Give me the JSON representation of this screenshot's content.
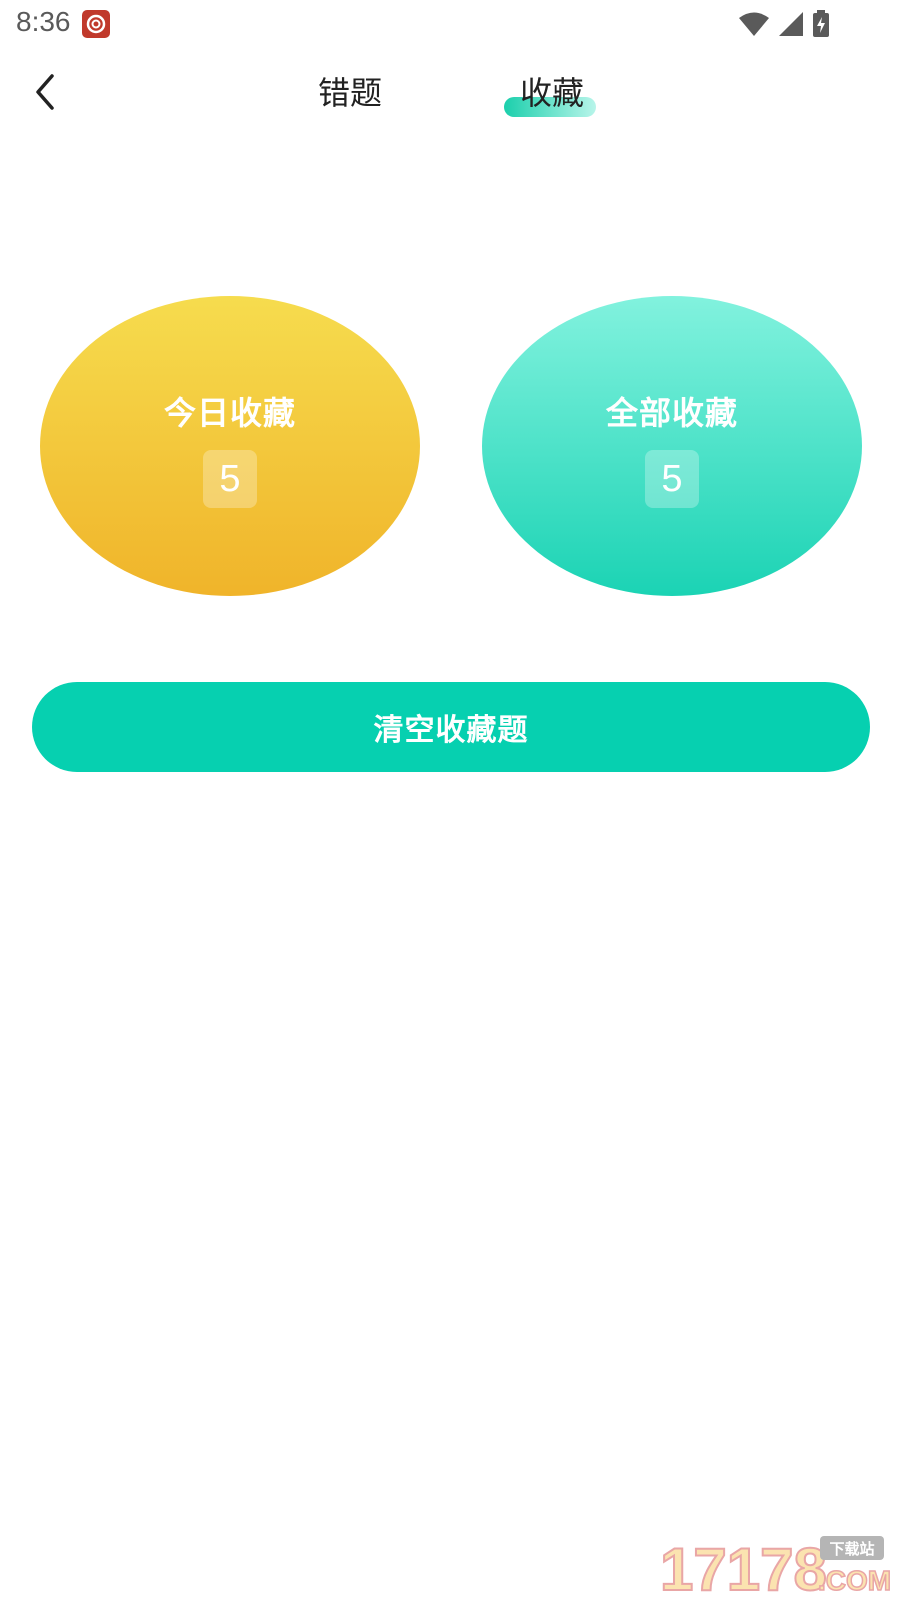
{
  "status_bar": {
    "time": "8:36",
    "icons": [
      "notification-app-icon",
      "wifi-icon",
      "signal-icon",
      "battery-charging-icon"
    ]
  },
  "nav": {
    "back_icon": "chevron-left-icon",
    "tabs": [
      {
        "label": "错题",
        "active": false
      },
      {
        "label": "收藏",
        "active": true
      }
    ]
  },
  "stats": {
    "today": {
      "label": "今日收藏",
      "count": "5"
    },
    "all": {
      "label": "全部收藏",
      "count": "5"
    }
  },
  "actions": {
    "clear_label": "清空收藏题"
  },
  "watermark": {
    "number": "17178",
    "tag": "下载站",
    "suffix": ".COM"
  },
  "colors": {
    "accent": "#06d0b0",
    "today_top": "#f6dc4e",
    "today_bottom": "#f0b42a",
    "all_top": "#82f2de",
    "all_bottom": "#1bd3b4"
  }
}
